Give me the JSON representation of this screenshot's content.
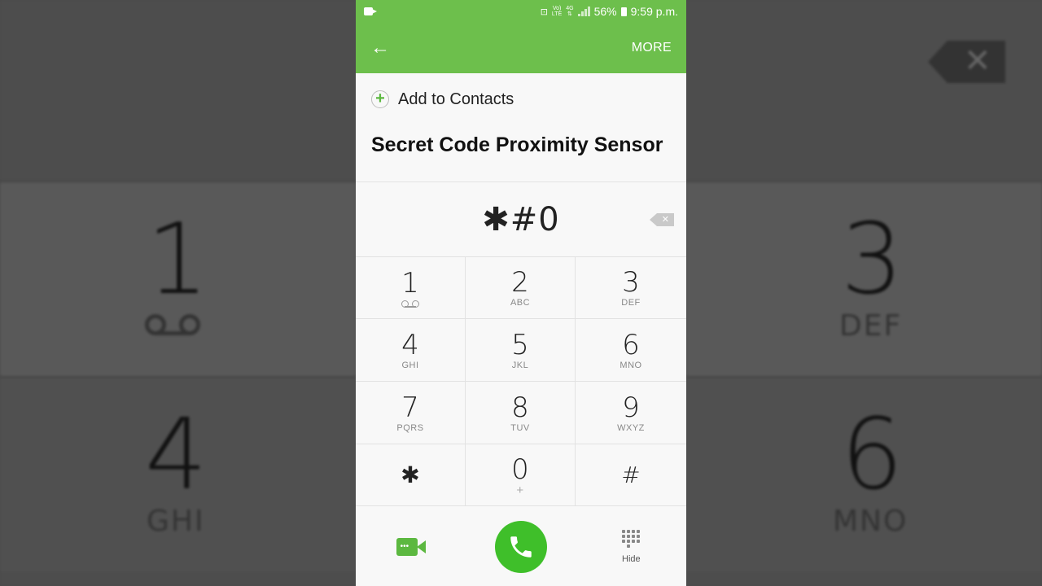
{
  "status_bar": {
    "network_top": "Vo)",
    "network_bottom": "LTE",
    "data_top": "4G",
    "data_bottom": "⇅",
    "battery": "56%",
    "time": "9:59 p.m."
  },
  "app_bar": {
    "back_icon": "arrow-left-icon",
    "more_label": "MORE"
  },
  "contact": {
    "add_label": "Add to Contacts",
    "name": "Secret Code Proximity Sensor"
  },
  "entry": {
    "digits": "✱#0"
  },
  "keypad": [
    {
      "digit": "1",
      "letters": ""
    },
    {
      "digit": "2",
      "letters": "ABC"
    },
    {
      "digit": "3",
      "letters": "DEF"
    },
    {
      "digit": "4",
      "letters": "GHI"
    },
    {
      "digit": "5",
      "letters": "JKL"
    },
    {
      "digit": "6",
      "letters": "MNO"
    },
    {
      "digit": "7",
      "letters": "PQRS"
    },
    {
      "digit": "8",
      "letters": "TUV"
    },
    {
      "digit": "9",
      "letters": "WXYZ"
    },
    {
      "digit": "✱",
      "letters": ""
    },
    {
      "digit": "0",
      "letters": "+"
    },
    {
      "digit": "#",
      "letters": ""
    }
  ],
  "bottom": {
    "hide_label": "Hide"
  },
  "background": {
    "left_top_digit": "1",
    "left_bottom_digit": "4",
    "left_bottom_letters": "GHI",
    "right_top_digit": "3",
    "right_top_letters": "DEF",
    "right_bottom_digit": "6",
    "right_bottom_letters": "MNO"
  },
  "colors": {
    "accent": "#6dbf4c",
    "call": "#3fbf2a"
  }
}
